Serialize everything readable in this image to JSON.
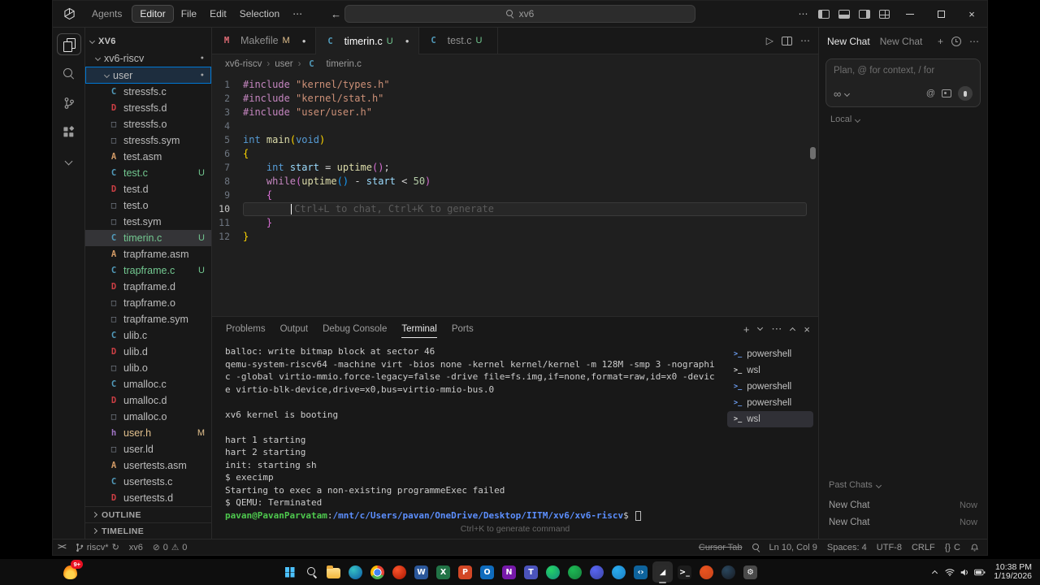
{
  "titlebar": {
    "mode_agents": "Agents",
    "mode_editor": "Editor",
    "menus": [
      "File",
      "Edit",
      "Selection",
      "⋯"
    ],
    "back_arrow": "←",
    "forward_arrow": "→",
    "search_value": "xv6"
  },
  "explorer": {
    "root": "XV6",
    "folders": [
      {
        "label": "xv6-riscv",
        "depth": 1,
        "dot": "●"
      },
      {
        "label": "user",
        "depth": 2,
        "dot": "●",
        "focused": true
      }
    ],
    "files": [
      {
        "name": "stressfs.c",
        "icon": "c"
      },
      {
        "name": "stressfs.d",
        "icon": "d"
      },
      {
        "name": "stressfs.o",
        "icon": "obj"
      },
      {
        "name": "stressfs.sym",
        "icon": "obj"
      },
      {
        "name": "test.asm",
        "icon": "asm"
      },
      {
        "name": "test.c",
        "icon": "c",
        "badge": "U"
      },
      {
        "name": "test.d",
        "icon": "d"
      },
      {
        "name": "test.o",
        "icon": "obj"
      },
      {
        "name": "test.sym",
        "icon": "obj"
      },
      {
        "name": "timerin.c",
        "icon": "c",
        "badge": "U",
        "selected": true
      },
      {
        "name": "trapframe.asm",
        "icon": "asm"
      },
      {
        "name": "trapframe.c",
        "icon": "c",
        "badge": "U"
      },
      {
        "name": "trapframe.d",
        "icon": "d"
      },
      {
        "name": "trapframe.o",
        "icon": "obj"
      },
      {
        "name": "trapframe.sym",
        "icon": "obj"
      },
      {
        "name": "ulib.c",
        "icon": "c"
      },
      {
        "name": "ulib.d",
        "icon": "d"
      },
      {
        "name": "ulib.o",
        "icon": "obj"
      },
      {
        "name": "umalloc.c",
        "icon": "c"
      },
      {
        "name": "umalloc.d",
        "icon": "d"
      },
      {
        "name": "umalloc.o",
        "icon": "obj"
      },
      {
        "name": "user.h",
        "icon": "h",
        "badge": "M"
      },
      {
        "name": "user.ld",
        "icon": "obj"
      },
      {
        "name": "usertests.asm",
        "icon": "asm"
      },
      {
        "name": "usertests.c",
        "icon": "c"
      },
      {
        "name": "usertests.d",
        "icon": "d"
      }
    ],
    "sections": [
      "OUTLINE",
      "TIMELINE"
    ]
  },
  "tabs": [
    {
      "name": "Makefile",
      "icon": "make",
      "git": "M",
      "dirty": true
    },
    {
      "name": "timerin.c",
      "icon": "c",
      "git": "U",
      "dirty": true,
      "active": true
    },
    {
      "name": "test.c",
      "icon": "c",
      "git": "U"
    }
  ],
  "breadcrumb": {
    "path": [
      "xv6-riscv",
      "user"
    ],
    "file": {
      "name": "timerin.c",
      "icon": "c"
    }
  },
  "editor": {
    "lines": [
      {
        "n": 1,
        "tk": [
          [
            "pp",
            "#include"
          ],
          [
            "pl",
            " "
          ],
          [
            "str",
            "\"kernel/types.h\""
          ]
        ]
      },
      {
        "n": 2,
        "tk": [
          [
            "pp",
            "#include"
          ],
          [
            "pl",
            " "
          ],
          [
            "str",
            "\"kernel/stat.h\""
          ]
        ]
      },
      {
        "n": 3,
        "tk": [
          [
            "pp",
            "#include"
          ],
          [
            "pl",
            " "
          ],
          [
            "str",
            "\"user/user.h\""
          ]
        ]
      },
      {
        "n": 4,
        "tk": []
      },
      {
        "n": 5,
        "tk": [
          [
            "type",
            "int"
          ],
          [
            "pl",
            " "
          ],
          [
            "fn",
            "main"
          ],
          [
            "b1",
            "("
          ],
          [
            "type",
            "void"
          ],
          [
            "b1",
            ")"
          ]
        ]
      },
      {
        "n": 6,
        "tk": [
          [
            "b1",
            "{"
          ]
        ]
      },
      {
        "n": 7,
        "tk": [
          [
            "pl",
            "    "
          ],
          [
            "type",
            "int"
          ],
          [
            "pl",
            " "
          ],
          [
            "var",
            "start"
          ],
          [
            "pl",
            " = "
          ],
          [
            "fn",
            "uptime"
          ],
          [
            "b2",
            "("
          ],
          [
            "b2",
            ")"
          ],
          [
            "pl",
            ";"
          ]
        ]
      },
      {
        "n": 8,
        "tk": [
          [
            "pl",
            "    "
          ],
          [
            "kw",
            "while"
          ],
          [
            "b2",
            "("
          ],
          [
            "fn",
            "uptime"
          ],
          [
            "b3",
            "("
          ],
          [
            "b3",
            ")"
          ],
          [
            "pl",
            " - "
          ],
          [
            "var",
            "start"
          ],
          [
            "pl",
            " < "
          ],
          [
            "num",
            "50"
          ],
          [
            "b2",
            ")"
          ]
        ]
      },
      {
        "n": 9,
        "tk": [
          [
            "pl",
            "    "
          ],
          [
            "b2",
            "{"
          ]
        ]
      },
      {
        "n": 10,
        "current": true,
        "tk": [
          [
            "pl",
            "        "
          ],
          [
            "caret",
            ""
          ],
          [
            "ghost",
            "Ctrl+L to chat, Ctrl+K to generate"
          ]
        ]
      },
      {
        "n": 11,
        "tk": [
          [
            "pl",
            "    "
          ],
          [
            "b2",
            "}"
          ]
        ]
      },
      {
        "n": 12,
        "tk": [
          [
            "b1",
            "}"
          ]
        ]
      }
    ]
  },
  "panel": {
    "tabs": [
      "Problems",
      "Output",
      "Debug Console",
      "Terminal",
      "Ports"
    ],
    "active_tab": "Terminal",
    "terminal": [
      [
        [
          "out",
          "balloc: write bitmap block at sector 46"
        ]
      ],
      [
        [
          "out",
          "qemu-system-riscv64 -machine virt -bios none -kernel kernel/kernel -m 128M -smp 3 -nographi"
        ]
      ],
      [
        [
          "out",
          "c -global virtio-mmio.force-legacy=false -drive file=fs.img,if=none,format=raw,id=x0 -devic"
        ]
      ],
      [
        [
          "out",
          "e virtio-blk-device,drive=x0,bus=virtio-mmio-bus.0"
        ]
      ],
      [],
      [
        [
          "out",
          "xv6 kernel is booting"
        ]
      ],
      [],
      [
        [
          "out",
          "hart 1 starting"
        ]
      ],
      [
        [
          "out",
          "hart 2 starting"
        ]
      ],
      [
        [
          "out",
          "init: starting sh"
        ]
      ],
      [
        [
          "out",
          "$ execimp"
        ]
      ],
      [
        [
          "out",
          "Starting to exec a non-existing programmeExec failed"
        ]
      ],
      [
        [
          "out",
          "$ QEMU: Terminated"
        ]
      ],
      [
        [
          "user",
          "pavan@PavanParvatam"
        ],
        [
          "out",
          ":"
        ],
        [
          "path",
          "/mnt/c/Users/pavan/OneDrive/Desktop/IITM/xv6/xv6-riscv"
        ],
        [
          "out",
          "$ "
        ],
        [
          "tcaret",
          ""
        ]
      ]
    ],
    "hint": "Ctrl+K to generate command",
    "sessions": [
      {
        "name": "powershell",
        "kind": "ps"
      },
      {
        "name": "wsl",
        "kind": "wsl"
      },
      {
        "name": "powershell",
        "kind": "ps"
      },
      {
        "name": "powershell",
        "kind": "ps"
      },
      {
        "name": "wsl",
        "kind": "wsl",
        "active": true
      }
    ]
  },
  "chat": {
    "tabs": [
      {
        "label": "New Chat",
        "active": true
      },
      {
        "label": "New Chat"
      }
    ],
    "placeholder": "Plan, @ for context, / for",
    "mode": "∞",
    "model": "Local",
    "past_label": "Past Chats",
    "past": [
      {
        "title": "New Chat",
        "time": "Now"
      },
      {
        "title": "New Chat",
        "time": "Now"
      }
    ]
  },
  "status": {
    "branch": "riscv*",
    "sync": "↻",
    "project": "xv6",
    "errors": "0",
    "warnings": "0",
    "cursor_tab": "Cursor Tab",
    "position": "Ln 10, Col 9",
    "indent": "Spaces: 4",
    "encoding": "UTF-8",
    "eol": "CRLF",
    "language_icon": "{}",
    "language": "C"
  },
  "taskbar": {
    "widget_badge": "9+",
    "clock_time": "10:38 PM",
    "clock_date": "1/19/2026",
    "apps": [
      {
        "name": "start",
        "shape": "start"
      },
      {
        "name": "search",
        "shape": "search"
      },
      {
        "name": "file-explorer",
        "shape": "folder",
        "color": "#f2b63c"
      },
      {
        "name": "edge",
        "shape": "circle",
        "color": "#35c1c4",
        "color2": "#0c59a4"
      },
      {
        "name": "chrome",
        "shape": "chrome"
      },
      {
        "name": "brave",
        "shape": "circle",
        "color": "#fb542b",
        "color2": "#a81500"
      },
      {
        "name": "word",
        "shape": "square",
        "color": "#2b579a",
        "glyph": "W"
      },
      {
        "name": "excel",
        "shape": "square",
        "color": "#217346",
        "glyph": "X"
      },
      {
        "name": "powerpoint",
        "shape": "square",
        "color": "#d24726",
        "glyph": "P"
      },
      {
        "name": "outlook",
        "shape": "square",
        "color": "#0f6cbd",
        "glyph": "O"
      },
      {
        "name": "onenote",
        "shape": "square",
        "color": "#7719aa",
        "glyph": "N"
      },
      {
        "name": "teams",
        "shape": "square",
        "color": "#4b53bc",
        "glyph": "T"
      },
      {
        "name": "whatsapp",
        "shape": "circle",
        "color": "#25d366",
        "color2": "#128c7e"
      },
      {
        "name": "spotify",
        "shape": "circle",
        "color": "#1db954",
        "color2": "#15803d"
      },
      {
        "name": "discord",
        "shape": "circle",
        "color": "#5865f2",
        "color2": "#3c45a5"
      },
      {
        "name": "telegram",
        "shape": "circle",
        "color": "#2aabee",
        "color2": "#1b7fc4"
      },
      {
        "name": "vscode",
        "shape": "square",
        "color": "#0e639c",
        "glyph": "‹›"
      },
      {
        "name": "cursor",
        "shape": "square",
        "color": "#2b2b2b",
        "glyph": "◢",
        "active": true
      },
      {
        "name": "terminal",
        "shape": "square",
        "color": "#1c1c1c",
        "glyph": ">_"
      },
      {
        "name": "ubuntu",
        "shape": "circle",
        "color": "#e95420",
        "color2": "#c7431a"
      },
      {
        "name": "steam",
        "shape": "circle",
        "color": "#2a475e",
        "color2": "#171a21"
      },
      {
        "name": "settings",
        "shape": "square",
        "color": "#4a4a4a",
        "glyph": "⚙"
      }
    ]
  }
}
